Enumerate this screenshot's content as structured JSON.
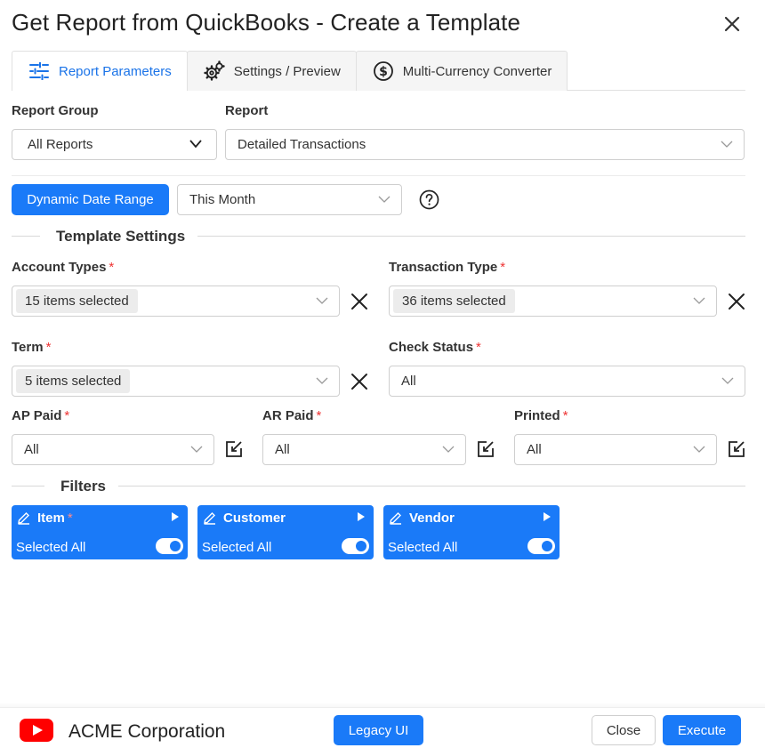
{
  "window": {
    "title": "Get Report from QuickBooks - Create a Template"
  },
  "tabs": [
    {
      "label": "Report Parameters",
      "icon": "sliders-icon",
      "active": true
    },
    {
      "label": "Settings / Preview",
      "icon": "gears-icon",
      "active": false
    },
    {
      "label": "Multi-Currency Converter",
      "icon": "dollar-circle-icon",
      "active": false
    }
  ],
  "report_group": {
    "label": "Report Group",
    "value": "All Reports"
  },
  "report": {
    "label": "Report",
    "value": "Detailed Transactions"
  },
  "date": {
    "button_label": "Dynamic Date Range",
    "value": "This Month"
  },
  "template_settings": {
    "title": "Template Settings",
    "account_types": {
      "label": "Account Types",
      "value": "15 items selected"
    },
    "transaction_type": {
      "label": "Transaction Type",
      "value": "36 items selected"
    },
    "term": {
      "label": "Term",
      "value": "5 items selected"
    },
    "check_status": {
      "label": "Check Status",
      "value": "All"
    },
    "ap_paid": {
      "label": "AP Paid",
      "value": "All"
    },
    "ar_paid": {
      "label": "AR Paid",
      "value": "All"
    },
    "printed": {
      "label": "Printed",
      "value": "All"
    },
    "required_marker": "*"
  },
  "filters": {
    "title": "Filters",
    "cards": [
      {
        "label": "Item",
        "required": true,
        "status": "Selected All",
        "toggle_on": true
      },
      {
        "label": "Customer",
        "required": false,
        "status": "Selected All",
        "toggle_on": true
      },
      {
        "label": "Vendor",
        "required": false,
        "status": "Selected All",
        "toggle_on": true
      }
    ]
  },
  "footer": {
    "company": "ACME Corporation",
    "legacy_label": "Legacy UI",
    "close_label": "Close",
    "execute_label": "Execute"
  },
  "colors": {
    "primary": "#1a7af8",
    "active_tab_text": "#1a73e8",
    "required": "#e33333",
    "logo_red": "#ff0000"
  }
}
